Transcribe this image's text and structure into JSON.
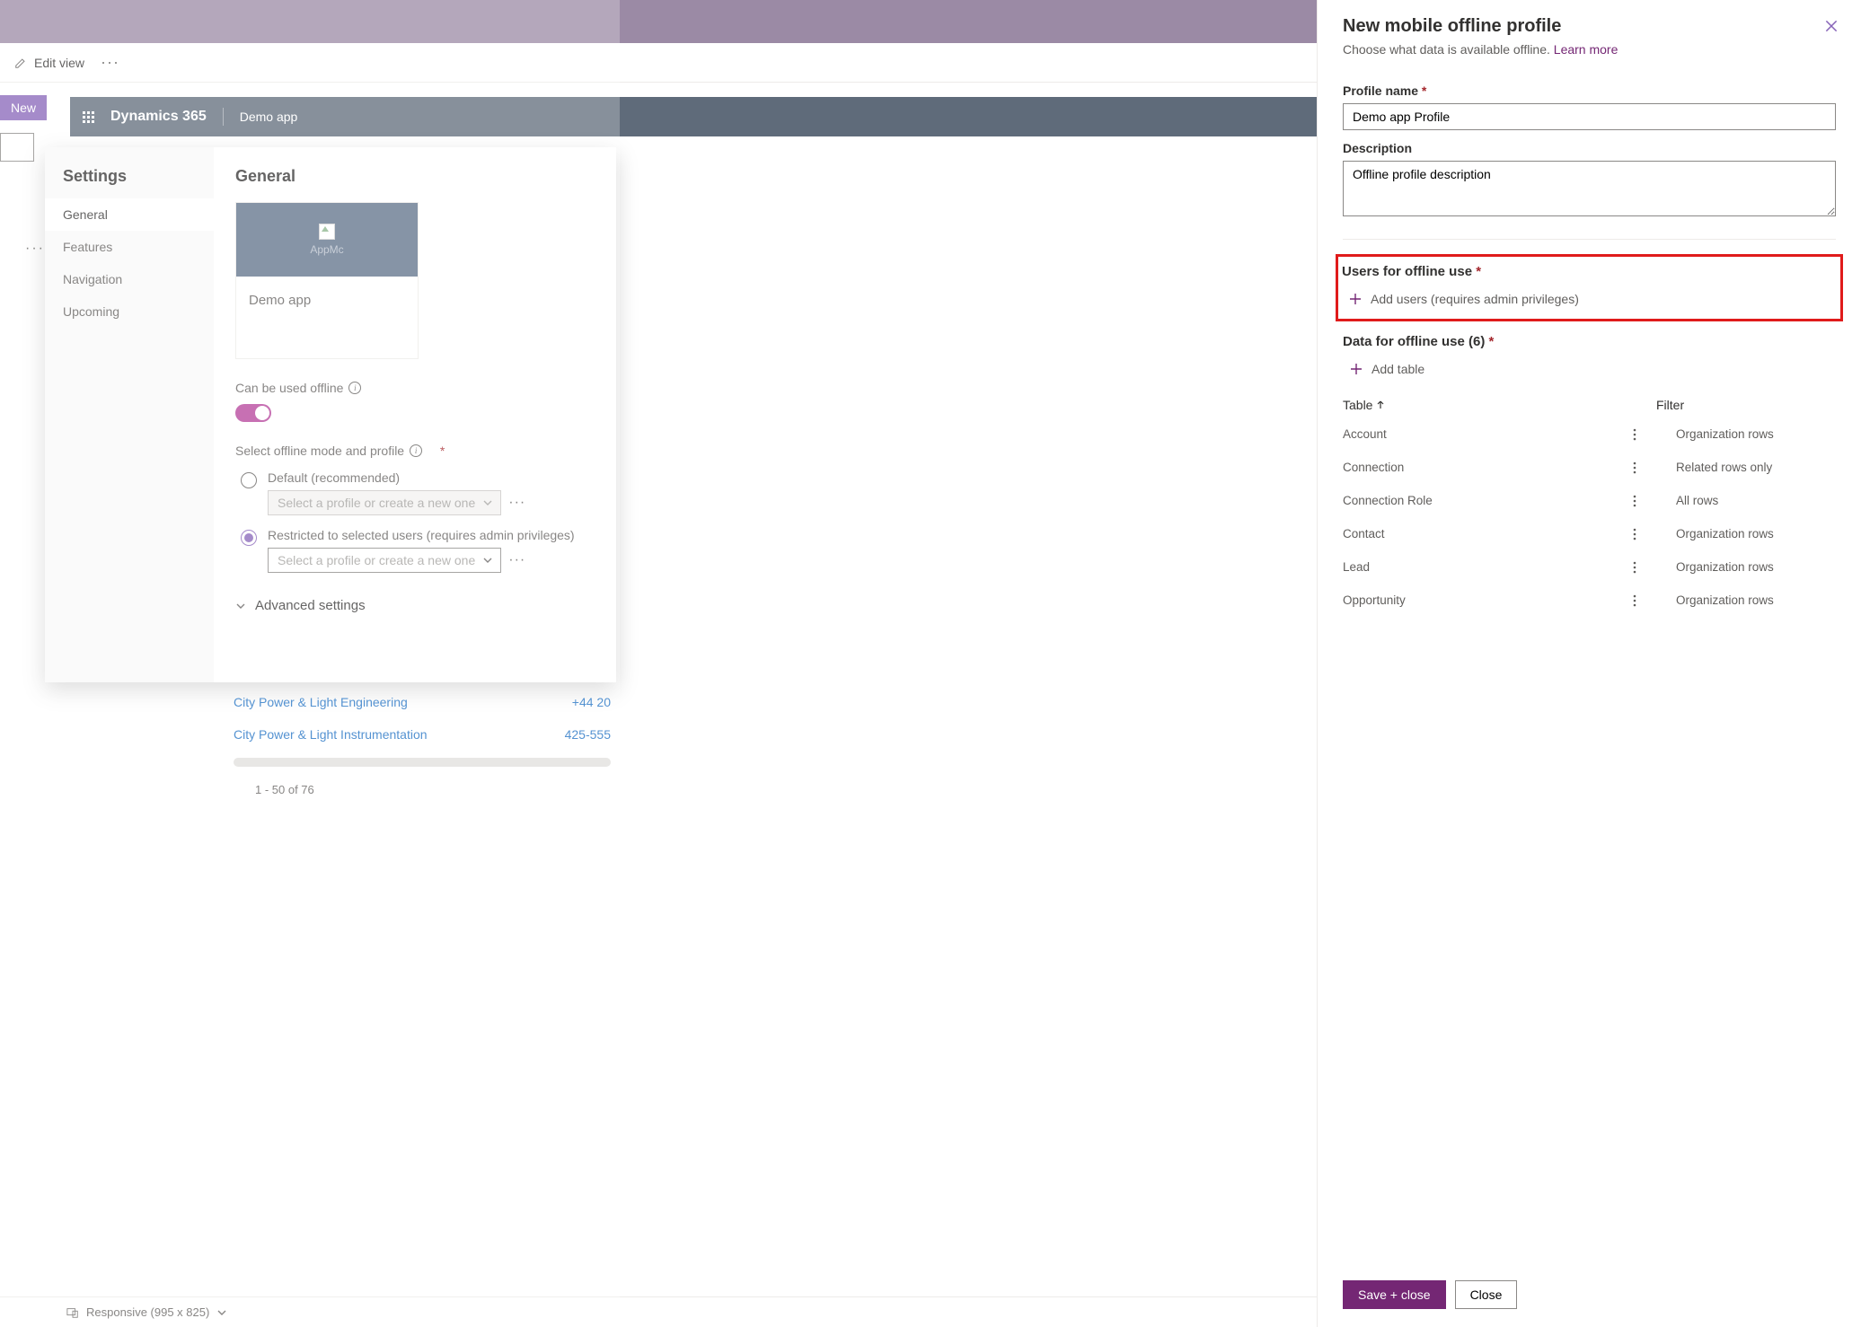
{
  "editBar": {
    "label": "Edit view"
  },
  "newBtn": "New",
  "appHeader": {
    "brand": "Dynamics 365",
    "app": "Demo app"
  },
  "settings": {
    "title": "Settings",
    "nav": [
      "General",
      "Features",
      "Navigation",
      "Upcoming"
    ],
    "heading": "General",
    "cardImgLabel": "AppMc",
    "cardName": "Demo app",
    "offlineLabel": "Can be used offline",
    "selectLabel": "Select offline mode and profile",
    "opt1": "Default (recommended)",
    "opt2": "Restricted to selected users (requires admin privileges)",
    "selectPlaceholder": "Select a profile or create a new one",
    "advanced": "Advanced settings"
  },
  "bgRows": [
    {
      "name": "City Power & Light Engineering",
      "phone": "+44 20"
    },
    {
      "name": "City Power & Light Instrumentation",
      "phone": "425-555"
    }
  ],
  "pager": "1 - 50 of 76",
  "footer": "Responsive (995 x 825)",
  "panel": {
    "title": "New mobile offline profile",
    "subtitle": "Choose what data is available offline.",
    "learnMore": "Learn more",
    "profileNameLabel": "Profile name",
    "profileNameValue": "Demo app Profile",
    "descLabel": "Description",
    "descValue": "Offline profile description",
    "usersHeading": "Users for offline use",
    "addUsers": "Add users (requires admin privileges)",
    "dataHeading": "Data for offline use (6)",
    "addTable": "Add table",
    "colTable": "Table",
    "colFilter": "Filter",
    "rows": [
      {
        "table": "Account",
        "filter": "Organization rows"
      },
      {
        "table": "Connection",
        "filter": "Related rows only"
      },
      {
        "table": "Connection Role",
        "filter": "All rows"
      },
      {
        "table": "Contact",
        "filter": "Organization rows"
      },
      {
        "table": "Lead",
        "filter": "Organization rows"
      },
      {
        "table": "Opportunity",
        "filter": "Organization rows"
      }
    ],
    "save": "Save + close",
    "close": "Close"
  }
}
